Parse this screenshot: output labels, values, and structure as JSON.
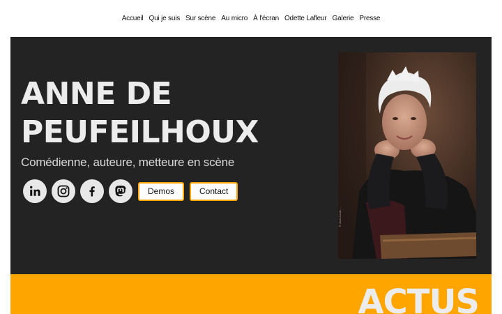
{
  "nav": {
    "items": [
      "Accueil",
      "Qui je suis",
      "Sur scène",
      "Au micro",
      "À l'écran",
      "Odette Lafleur",
      "Galerie",
      "Presse"
    ]
  },
  "hero": {
    "title": "ANNE DE PEUFEILHOUX",
    "subtitle": "Comédienne, auteure, metteure en scène",
    "social": [
      {
        "icon": "linkedin-icon"
      },
      {
        "icon": "instagram-icon"
      },
      {
        "icon": "facebook-icon"
      },
      {
        "icon": "mastodon-icon"
      }
    ],
    "buttons": {
      "demos": "Demos",
      "contact": "Contact"
    },
    "photo_credit": "© Jean-Louis ..."
  },
  "actus": {
    "title": "ACTUS"
  },
  "colors": {
    "accent": "#ffa500",
    "hero_bg": "#232323",
    "title": "#ececec"
  }
}
